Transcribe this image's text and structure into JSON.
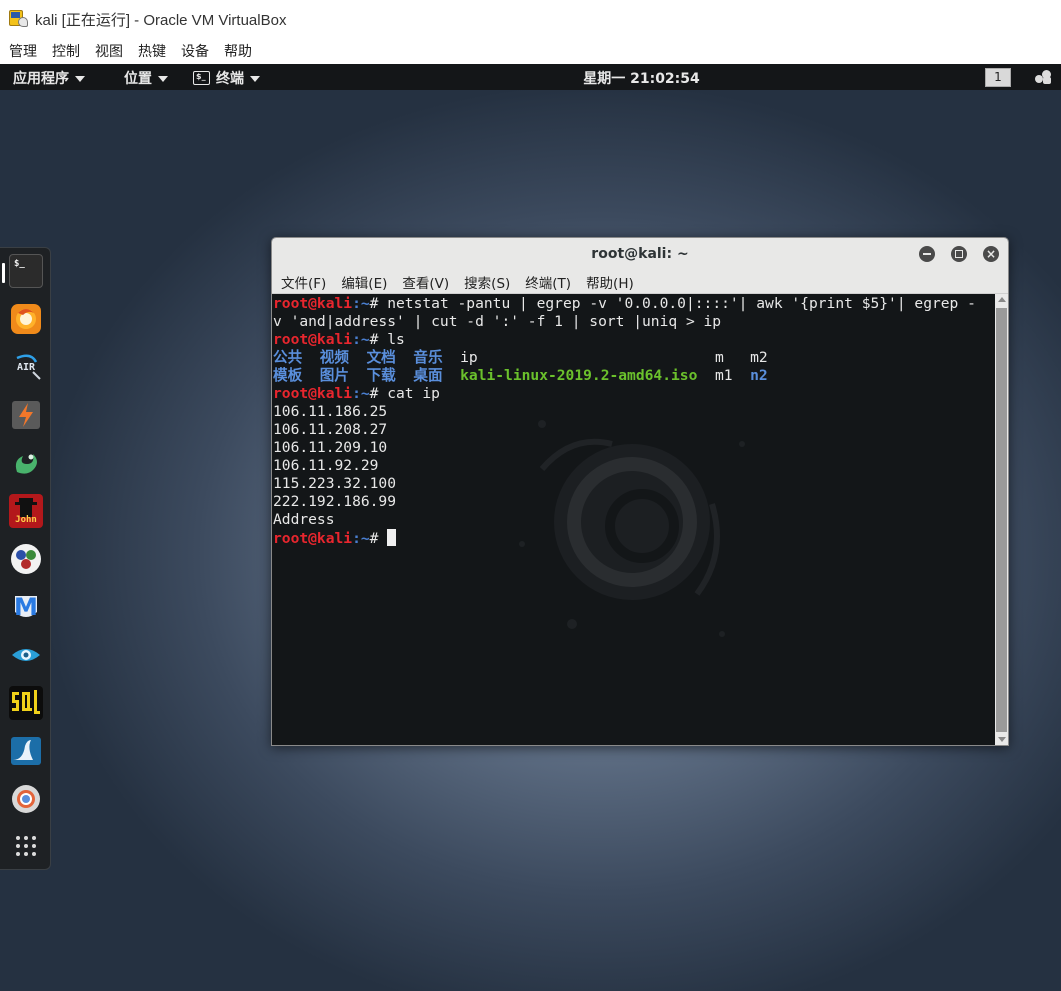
{
  "vbox": {
    "title": "kali [正在运行] - Oracle VM VirtualBox",
    "menu": [
      "管理",
      "控制",
      "视图",
      "热键",
      "设备",
      "帮助"
    ]
  },
  "topbar": {
    "applications": "应用程序",
    "places": "位置",
    "terminal": "终端",
    "terminal_icon_text": "$_",
    "clock": "星期一 21:02:54",
    "workspace": "1"
  },
  "dock": {
    "items": [
      "terminal-icon",
      "firefox-icon",
      "aircrack-icon",
      "burpsuite-icon",
      "maltego-icon",
      "john-icon",
      "armitage-icon",
      "metasploit-icon",
      "faraday-icon",
      "sqlmap-icon",
      "wireshark-icon",
      "chromium-icon",
      "show-apps-icon"
    ],
    "terminal_icon_text": "$_",
    "air_icon_text": "AIR",
    "john_icon_text": "John",
    "metasploit_icon_text": "M"
  },
  "terminal": {
    "title": "root@kali: ~",
    "menu": [
      "文件(F)",
      "编辑(E)",
      "查看(V)",
      "搜索(S)",
      "终端(T)",
      "帮助(H)"
    ],
    "prompt_user": "root@kali",
    "prompt_path": ":~",
    "prompt_hash": "# ",
    "cmd1_line1": "netstat -pantu | egrep -v '0.0.0.0|::::'| awk '{print $5}'| egrep -",
    "cmd1_line2": "v 'and|address' | cut -d ':' -f 1 | sort |uniq > ip",
    "cmd2": "ls",
    "ls_row1": [
      {
        "text": "公共",
        "kind": "dir"
      },
      {
        "text": "视频",
        "kind": "dir"
      },
      {
        "text": "文档",
        "kind": "dir"
      },
      {
        "text": "音乐",
        "kind": "dir"
      },
      {
        "text": "ip",
        "kind": "file"
      },
      {
        "text": "m",
        "kind": "file"
      },
      {
        "text": "m2",
        "kind": "file"
      }
    ],
    "ls_row2": [
      {
        "text": "模板",
        "kind": "dir"
      },
      {
        "text": "图片",
        "kind": "dir"
      },
      {
        "text": "下载",
        "kind": "dir"
      },
      {
        "text": "桌面",
        "kind": "dir"
      },
      {
        "text": "kali-linux-2019.2-amd64.iso",
        "kind": "archive"
      },
      {
        "text": "m1",
        "kind": "file"
      },
      {
        "text": "n2",
        "kind": "dir"
      }
    ],
    "cmd3": "cat ip",
    "output": [
      "106.11.186.25",
      "106.11.208.27",
      "106.11.209.10",
      "106.11.92.29",
      "115.223.32.100",
      "222.192.186.99",
      "Address"
    ],
    "colors": {
      "prompt_user": "#e8262e",
      "prompt_path": "#4a7fd0",
      "directory": "#5a8fdc",
      "archive": "#6bc12c",
      "background": "#131618"
    }
  }
}
